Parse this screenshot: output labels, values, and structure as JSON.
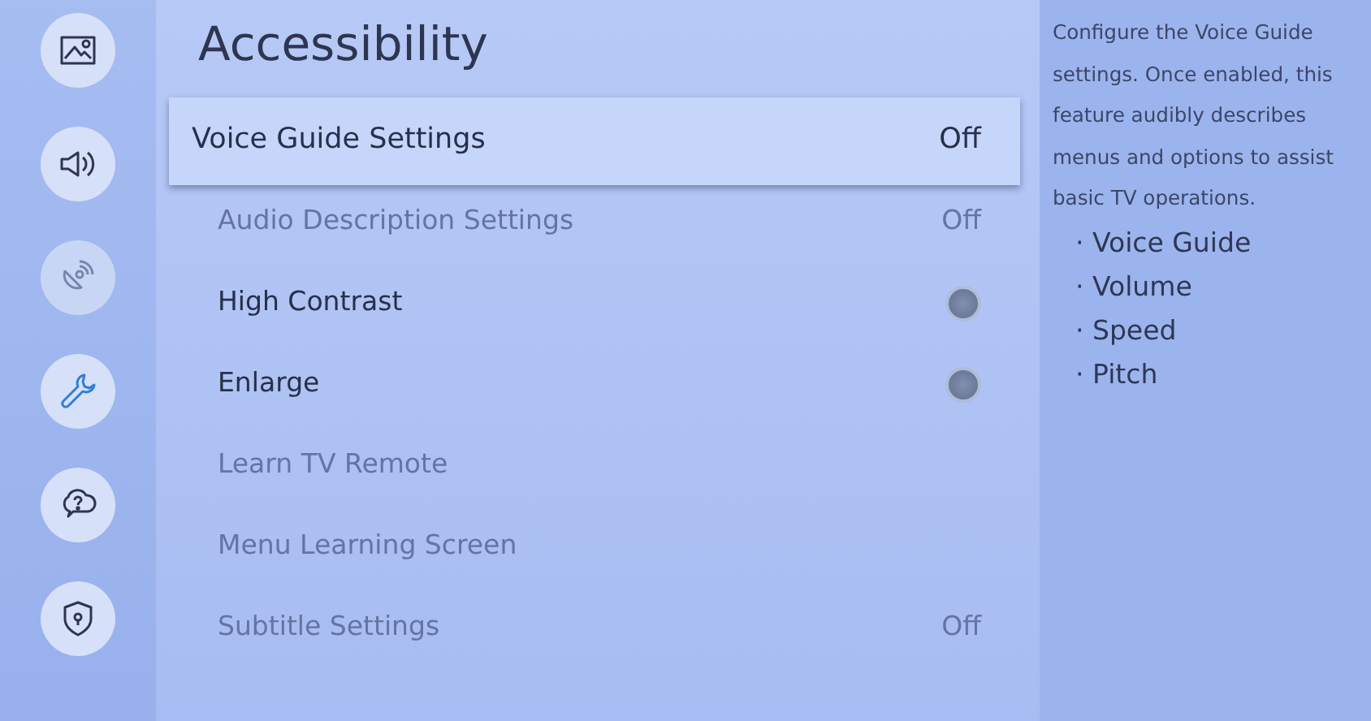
{
  "sidebar": {
    "items": [
      {
        "selected": false,
        "disabled": false
      },
      {
        "selected": false,
        "disabled": false
      },
      {
        "selected": false,
        "disabled": true
      },
      {
        "selected": true,
        "disabled": false
      },
      {
        "selected": false,
        "disabled": false
      },
      {
        "selected": false,
        "disabled": false
      }
    ]
  },
  "title": "Accessibility",
  "menu": [
    {
      "label": "Voice Guide Settings",
      "kind": "value",
      "value": "Off",
      "selected": true,
      "disabled": false
    },
    {
      "label": "Audio Description Settings",
      "kind": "value",
      "value": "Off",
      "selected": false,
      "disabled": true
    },
    {
      "label": "High Contrast",
      "kind": "toggle",
      "on": false,
      "selected": false,
      "disabled": false
    },
    {
      "label": "Enlarge",
      "kind": "toggle",
      "on": false,
      "selected": false,
      "disabled": false
    },
    {
      "label": "Learn TV Remote",
      "kind": "plain",
      "selected": false,
      "disabled": true
    },
    {
      "label": "Menu Learning Screen",
      "kind": "plain",
      "selected": false,
      "disabled": true
    },
    {
      "label": "Subtitle Settings",
      "kind": "value",
      "value": "Off",
      "selected": false,
      "disabled": true
    }
  ],
  "help": {
    "text": "Configure the Voice Guide settings. Once enabled, this feature audibly describes menus and options to assist basic TV operations.",
    "bullets": [
      "· Voice Guide",
      "· Volume",
      "· Speed",
      "· Pitch"
    ]
  }
}
